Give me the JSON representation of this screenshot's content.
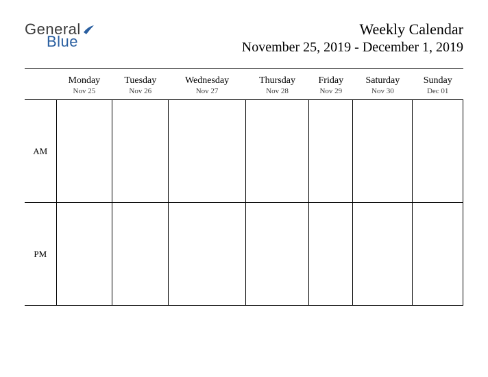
{
  "logo": {
    "text_general": "General",
    "text_blue": "Blue"
  },
  "header": {
    "title": "Weekly Calendar",
    "date_range": "November 25, 2019 - December 1, 2019"
  },
  "days": [
    {
      "name": "Monday",
      "date": "Nov 25"
    },
    {
      "name": "Tuesday",
      "date": "Nov 26"
    },
    {
      "name": "Wednesday",
      "date": "Nov 27"
    },
    {
      "name": "Thursday",
      "date": "Nov 28"
    },
    {
      "name": "Friday",
      "date": "Nov 29"
    },
    {
      "name": "Saturday",
      "date": "Nov 30"
    },
    {
      "name": "Sunday",
      "date": "Dec 01"
    }
  ],
  "periods": {
    "am": "AM",
    "pm": "PM"
  }
}
